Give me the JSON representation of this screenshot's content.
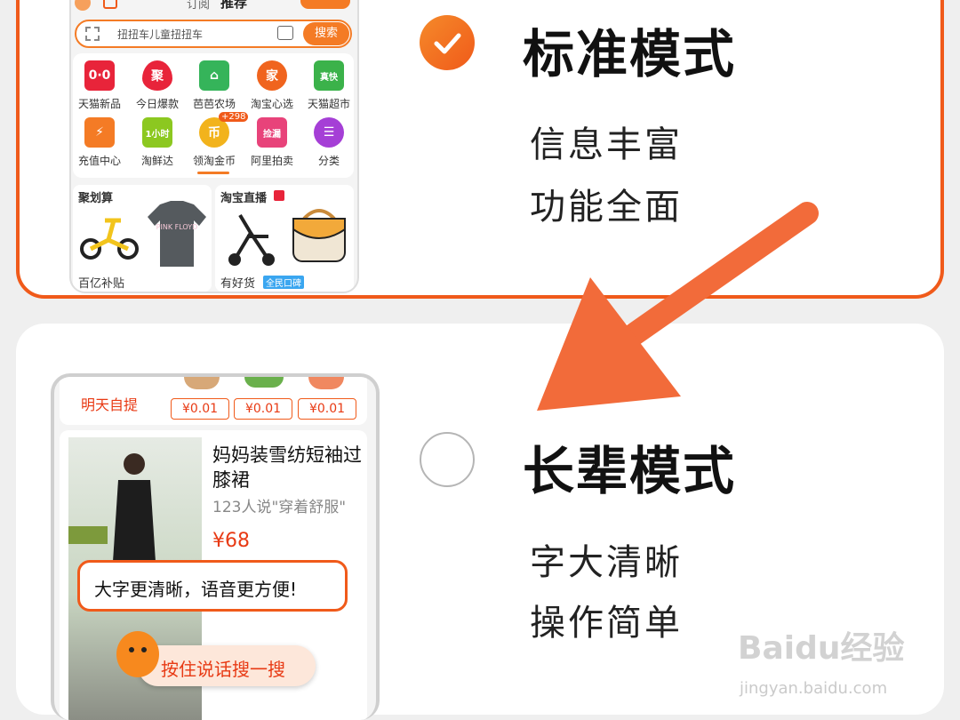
{
  "standard_mode": {
    "title": "标准模式",
    "features": [
      "信息丰富",
      "功能全面"
    ],
    "selected": true,
    "phone": {
      "tabs": [
        "订阅",
        "推荐"
      ],
      "search_placeholder": "扭扭车儿童扭扭车",
      "search_button": "搜索",
      "grid": [
        {
          "label": "天猫新品",
          "icon": "tmall-new-icon",
          "glyph": "0·0"
        },
        {
          "label": "今日爆款",
          "icon": "hot-sale-icon",
          "glyph": "聚"
        },
        {
          "label": "芭芭农场",
          "icon": "farm-icon",
          "glyph": "⌂"
        },
        {
          "label": "淘宝心选",
          "icon": "taobao-select-icon",
          "glyph": "家"
        },
        {
          "label": "天猫超市",
          "icon": "tmall-market-icon",
          "glyph": "真快"
        },
        {
          "label": "充值中心",
          "icon": "recharge-icon",
          "glyph": "⚡"
        },
        {
          "label": "淘鲜达",
          "icon": "fresh-icon",
          "glyph": "1小时"
        },
        {
          "label": "领淘金币",
          "icon": "coin-icon",
          "glyph": "币"
        },
        {
          "label": "阿里拍卖",
          "icon": "auction-icon",
          "glyph": "捡漏"
        },
        {
          "label": "分类",
          "icon": "category-icon",
          "glyph": "☰"
        }
      ],
      "coin_badge": "+298",
      "sections": [
        "聚划算",
        "淘宝直播",
        "百亿补贴",
        "有好货"
      ],
      "tags": [
        "全民口碑"
      ],
      "tshirt_print": "PINK FLOYD"
    }
  },
  "elder_mode": {
    "title": "长辈模式",
    "features": [
      "字大清晰",
      "操作简单"
    ],
    "selected": false,
    "phone": {
      "pickup_label": "明天自提",
      "prices": [
        "¥0.01",
        "¥0.01",
        "¥0.01"
      ],
      "product_title": "妈妈装雪纺短袖过膝裙",
      "product_review": "123人说\"穿着舒服\"",
      "product_price": "¥68",
      "bubble_text": "大字更清晰，语音更方便!",
      "voice_button": "按住说话搜一搜"
    }
  },
  "watermark": {
    "brand": "Baidu经验",
    "url": "jingyan.baidu.com"
  },
  "colors": {
    "accent": "#f05a1a",
    "arrow": "#f26b3a"
  }
}
